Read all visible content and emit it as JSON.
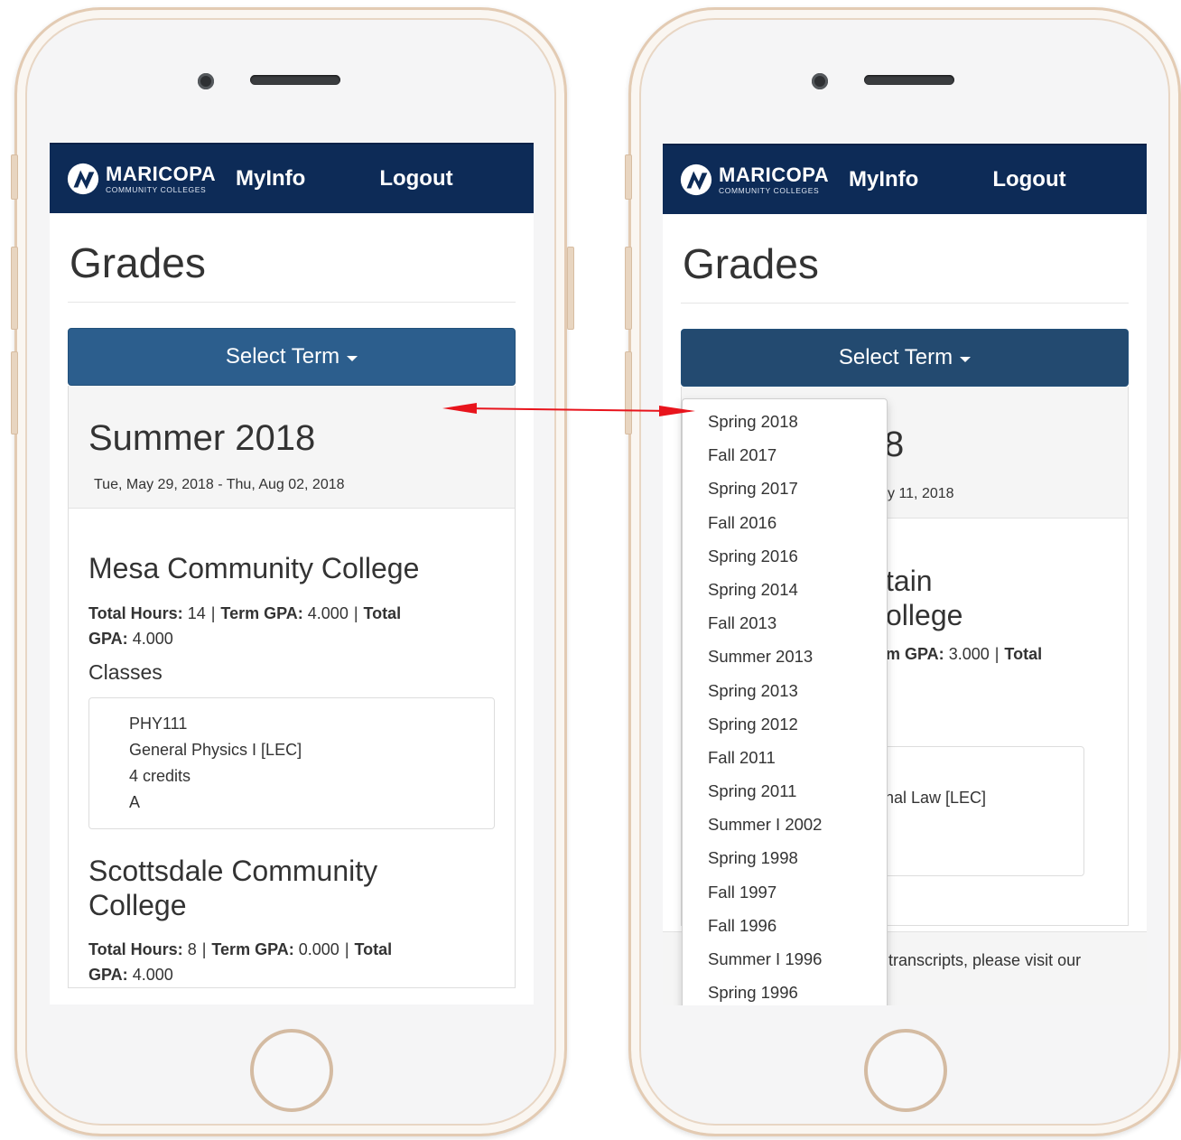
{
  "brand": {
    "name": "MARICOPA",
    "sub": "COMMUNITY COLLEGES"
  },
  "nav": {
    "myinfo": "MyInfo",
    "logout": "Logout"
  },
  "page": {
    "title": "Grades"
  },
  "select_term": {
    "label": "Select Term"
  },
  "left": {
    "term": {
      "title": "Summer 2018",
      "dates": "Tue, May 29, 2018 - Thu, Aug 02, 2018"
    },
    "colleges": [
      {
        "name": "Mesa Community College",
        "stats": {
          "total_hours_label": "Total Hours:",
          "total_hours": "14",
          "term_gpa_label": "Term GPA:",
          "term_gpa": "4.000",
          "total_gpa_label": "Total",
          "total_gpa_label2": "GPA:",
          "total_gpa": "4.000"
        },
        "classes_label": "Classes",
        "classes": [
          {
            "code": "PHY111",
            "title": "General Physics I [LEC]",
            "credits": "4 credits",
            "grade": "A"
          }
        ]
      },
      {
        "name_line1": "Scottsdale Community",
        "name_line2": "College",
        "stats": {
          "total_hours_label": "Total Hours:",
          "total_hours": "8",
          "term_gpa_label": "Term GPA:",
          "term_gpa": "0.000",
          "total_gpa_label": "Total",
          "total_gpa_label2": "GPA:",
          "total_gpa": "4.000"
        }
      }
    ]
  },
  "right": {
    "term_fragment": "8",
    "dates_fragment": "y 11, 2018",
    "college_fragment_line1": "tain",
    "college_fragment_line2": "ollege",
    "stats_fragment": {
      "term_gpa_label": "m GPA:",
      "term_gpa": "3.000",
      "total_label": "Total"
    },
    "class_fragment": "nal Law [LEC]",
    "footer_fragment": "transcripts, please visit our",
    "dropdown_terms": [
      "Spring 2018",
      "Fall 2017",
      "Spring 2017",
      "Fall 2016",
      "Spring 2016",
      "Spring 2014",
      "Fall 2013",
      "Summer 2013",
      "Spring 2013",
      "Spring 2012",
      "Fall 2011",
      "Spring 2011",
      "Summer I 2002",
      "Spring 1998",
      "Fall 1997",
      "Fall 1996",
      "Summer I 1996",
      "Spring 1996"
    ]
  },
  "colors": {
    "navbar": "#0d2b57",
    "button": "#2c5e8d",
    "arrow": "#e8141c",
    "phone_frame": "#e3cbb3"
  }
}
